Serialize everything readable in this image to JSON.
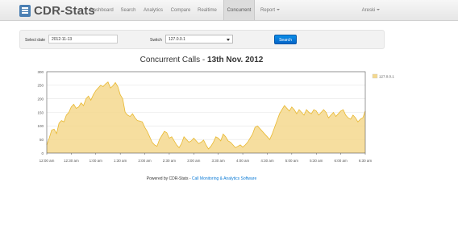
{
  "nav": {
    "brand": "CDR-Stats",
    "items": [
      "Dashboard",
      "Search",
      "Analytics",
      "Compare",
      "Realtime",
      "Concurrent"
    ],
    "report": "Report",
    "user": "Areski"
  },
  "filters": {
    "date_label": "Select date",
    "date_value": "2012-11-13",
    "switch_label": "Switch",
    "switch_value": "127.0.0.1",
    "search_label": "Search"
  },
  "chart_data": {
    "type": "area",
    "title_prefix": "Concurrent Calls - ",
    "title_bold": "13th Nov. 2012",
    "legend": "127.0.0.1",
    "ylim": [
      0,
      300
    ],
    "y_ticks": [
      0,
      50,
      100,
      150,
      200,
      250,
      300
    ],
    "x_tick_labels": [
      "12:00 am",
      "12:30 am",
      "1:00 am",
      "1:30 am",
      "2:00 am",
      "2:30 am",
      "3:00 am",
      "3:30 am",
      "4:00 am",
      "4:30 am",
      "5:00 am",
      "5:30 am",
      "6:00 am",
      "6:30 am"
    ],
    "x_hours": [
      0,
      6.5
    ],
    "color": "#f4d88e",
    "line_color": "#e8b830",
    "points": [
      [
        0.0,
        30
      ],
      [
        0.05,
        55
      ],
      [
        0.1,
        85
      ],
      [
        0.15,
        88
      ],
      [
        0.2,
        72
      ],
      [
        0.25,
        110
      ],
      [
        0.3,
        120
      ],
      [
        0.35,
        115
      ],
      [
        0.4,
        140
      ],
      [
        0.45,
        150
      ],
      [
        0.5,
        170
      ],
      [
        0.55,
        180
      ],
      [
        0.6,
        165
      ],
      [
        0.65,
        170
      ],
      [
        0.7,
        185
      ],
      [
        0.75,
        175
      ],
      [
        0.8,
        200
      ],
      [
        0.85,
        210
      ],
      [
        0.9,
        195
      ],
      [
        0.95,
        215
      ],
      [
        1.0,
        230
      ],
      [
        1.05,
        240
      ],
      [
        1.1,
        250
      ],
      [
        1.15,
        245
      ],
      [
        1.2,
        255
      ],
      [
        1.25,
        262
      ],
      [
        1.3,
        240
      ],
      [
        1.35,
        248
      ],
      [
        1.4,
        260
      ],
      [
        1.45,
        245
      ],
      [
        1.5,
        215
      ],
      [
        1.55,
        200
      ],
      [
        1.6,
        150
      ],
      [
        1.65,
        140
      ],
      [
        1.7,
        135
      ],
      [
        1.75,
        145
      ],
      [
        1.8,
        130
      ],
      [
        1.85,
        120
      ],
      [
        1.9,
        118
      ],
      [
        1.95,
        115
      ],
      [
        2.0,
        95
      ],
      [
        2.05,
        80
      ],
      [
        2.1,
        60
      ],
      [
        2.15,
        40
      ],
      [
        2.2,
        30
      ],
      [
        2.25,
        25
      ],
      [
        2.3,
        50
      ],
      [
        2.35,
        65
      ],
      [
        2.4,
        80
      ],
      [
        2.45,
        75
      ],
      [
        2.5,
        55
      ],
      [
        2.55,
        60
      ],
      [
        2.6,
        45
      ],
      [
        2.65,
        30
      ],
      [
        2.7,
        20
      ],
      [
        2.75,
        35
      ],
      [
        2.8,
        60
      ],
      [
        2.85,
        50
      ],
      [
        2.9,
        40
      ],
      [
        2.95,
        45
      ],
      [
        3.0,
        55
      ],
      [
        3.05,
        45
      ],
      [
        3.1,
        35
      ],
      [
        3.15,
        40
      ],
      [
        3.2,
        48
      ],
      [
        3.25,
        30
      ],
      [
        3.3,
        15
      ],
      [
        3.35,
        25
      ],
      [
        3.4,
        40
      ],
      [
        3.45,
        60
      ],
      [
        3.5,
        55
      ],
      [
        3.55,
        45
      ],
      [
        3.6,
        70
      ],
      [
        3.65,
        60
      ],
      [
        3.7,
        45
      ],
      [
        3.75,
        40
      ],
      [
        3.8,
        30
      ],
      [
        3.85,
        20
      ],
      [
        3.9,
        25
      ],
      [
        3.95,
        30
      ],
      [
        4.0,
        22
      ],
      [
        4.05,
        30
      ],
      [
        4.1,
        40
      ],
      [
        4.15,
        55
      ],
      [
        4.2,
        70
      ],
      [
        4.25,
        95
      ],
      [
        4.3,
        100
      ],
      [
        4.35,
        90
      ],
      [
        4.4,
        80
      ],
      [
        4.45,
        70
      ],
      [
        4.5,
        60
      ],
      [
        4.55,
        50
      ],
      [
        4.6,
        70
      ],
      [
        4.65,
        95
      ],
      [
        4.7,
        120
      ],
      [
        4.75,
        145
      ],
      [
        4.8,
        160
      ],
      [
        4.85,
        175
      ],
      [
        4.9,
        165
      ],
      [
        4.95,
        155
      ],
      [
        5.0,
        170
      ],
      [
        5.05,
        160
      ],
      [
        5.1,
        145
      ],
      [
        5.15,
        160
      ],
      [
        5.2,
        150
      ],
      [
        5.25,
        140
      ],
      [
        5.3,
        160
      ],
      [
        5.35,
        150
      ],
      [
        5.4,
        145
      ],
      [
        5.45,
        160
      ],
      [
        5.5,
        155
      ],
      [
        5.55,
        140
      ],
      [
        5.6,
        150
      ],
      [
        5.65,
        160
      ],
      [
        5.7,
        150
      ],
      [
        5.75,
        130
      ],
      [
        5.8,
        140
      ],
      [
        5.85,
        150
      ],
      [
        5.9,
        135
      ],
      [
        5.95,
        145
      ],
      [
        6.0,
        155
      ],
      [
        6.05,
        160
      ],
      [
        6.1,
        140
      ],
      [
        6.15,
        130
      ],
      [
        6.2,
        125
      ],
      [
        6.25,
        140
      ],
      [
        6.3,
        130
      ],
      [
        6.35,
        115
      ],
      [
        6.4,
        125
      ],
      [
        6.45,
        130
      ],
      [
        6.5,
        155
      ]
    ]
  },
  "footer": {
    "prefix": "Powered by CDR-Stats - ",
    "link": "Call Monitoring & Analytics Software"
  }
}
